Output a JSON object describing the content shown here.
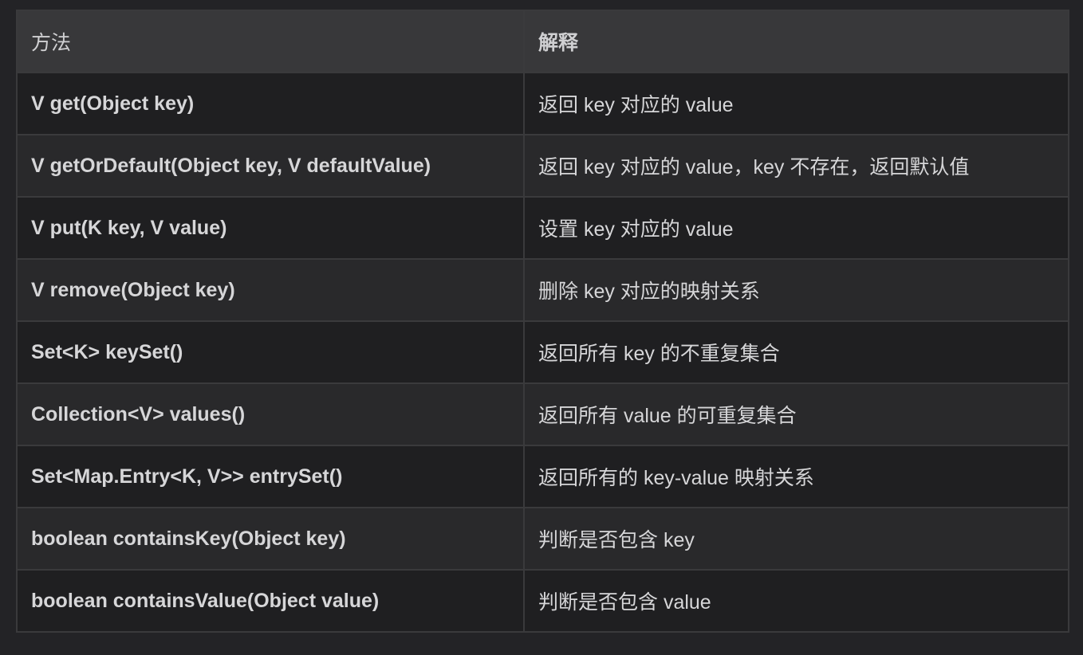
{
  "table": {
    "headers": {
      "method": "方法",
      "description": "解释"
    },
    "rows": [
      {
        "method": "V get(Object key)",
        "description": "返回 key 对应的 value"
      },
      {
        "method": "V getOrDefault(Object key, V defaultValue)",
        "description": "返回 key 对应的 value，key 不存在，返回默认值"
      },
      {
        "method": "V put(K key, V value)",
        "description": "设置 key 对应的 value"
      },
      {
        "method": "V remove(Object key)",
        "description": "删除 key 对应的映射关系"
      },
      {
        "method": "Set<K> keySet()",
        "description": "返回所有 key 的不重复集合"
      },
      {
        "method": "Collection<V> values()",
        "description": "返回所有 value 的可重复集合"
      },
      {
        "method": "Set<Map.Entry<K, V>> entrySet()",
        "description": "返回所有的 key-value 映射关系"
      },
      {
        "method": "boolean containsKey(Object key)",
        "description": "判断是否包含 key"
      },
      {
        "method": "boolean containsValue(Object value)",
        "description": "判断是否包含 value"
      }
    ]
  }
}
